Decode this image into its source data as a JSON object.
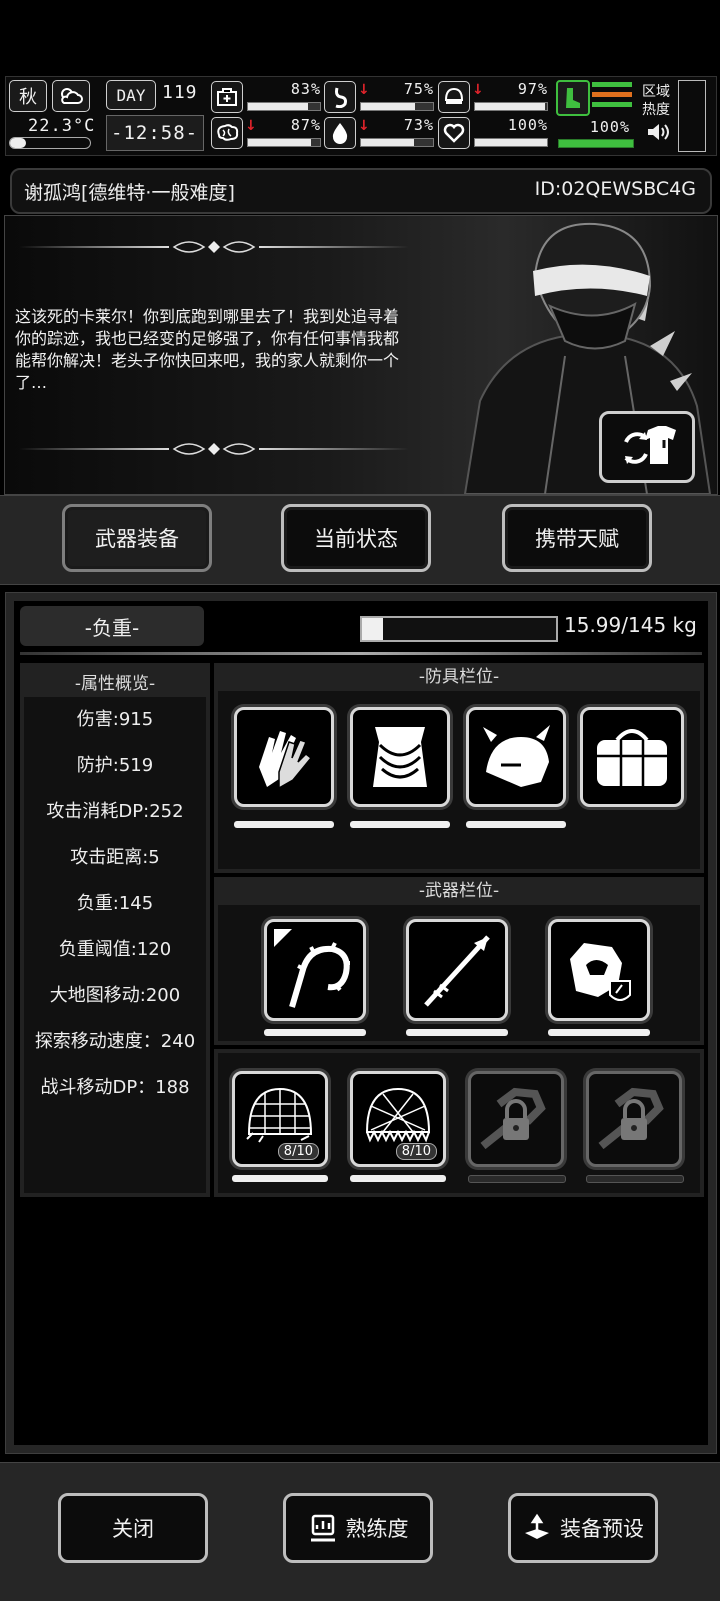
{
  "status": {
    "season": "秋",
    "temperature": "22.3°C",
    "day_label": "DAY",
    "day_number": "119",
    "clock": "-12:58-",
    "stats": [
      {
        "icon": "medkit-icon",
        "value": "83%",
        "fill": 0.83,
        "down": false
      },
      {
        "icon": "stomach-icon",
        "value": "75%",
        "fill": 0.75,
        "down": true
      },
      {
        "icon": "helmet-icon",
        "value": "97%",
        "fill": 0.97,
        "down": true
      },
      {
        "icon": "brain-icon",
        "value": "87%",
        "fill": 0.87,
        "down": true
      },
      {
        "icon": "water-drop-icon",
        "value": "73%",
        "fill": 0.73,
        "down": true
      },
      {
        "icon": "heart-icon",
        "value": "100%",
        "fill": 1.0,
        "down": false
      }
    ],
    "stamina_value": "100%",
    "region_heat_label": "区域热度",
    "colors": {
      "accent_green": "#3fbf3f",
      "accent_orange": "#e0701e",
      "alert_red": "#e0232b"
    }
  },
  "player": {
    "name": "谢孤鸿[德维特·一般难度]",
    "id": "ID:02QEWSBC4G"
  },
  "story": {
    "text": "这该死的卡莱尔！你到底跑到哪里去了！我到处追寻着你的踪迹，我也已经变的足够强了，你有任何事情我都能帮你解决！老头子你快回来吧，我的家人就剩你一个了…"
  },
  "tabs": [
    {
      "label": "武器装备",
      "active": true
    },
    {
      "label": "当前状态",
      "active": false
    },
    {
      "label": "携带天赋",
      "active": false
    }
  ],
  "load": {
    "label": "-负重-",
    "text": "15.99/145 kg",
    "fraction": 0.11
  },
  "attributes": {
    "header": "-属性概览-",
    "items": [
      "伤害:915",
      "防护:519",
      "攻击消耗DP:252",
      "攻击距离:5",
      "负重:145",
      "负重阈值:120",
      "大地图移动:200",
      "探索移动速度：240",
      "战斗移动DP：188"
    ]
  },
  "armor": {
    "header": "-防具栏位-",
    "slots": [
      {
        "icon": "gloves-icon",
        "durability": 1.0
      },
      {
        "icon": "vest-icon",
        "durability": 1.0
      },
      {
        "icon": "horned-helmet-icon",
        "durability": 1.0
      },
      {
        "icon": "bag-icon",
        "durability": null
      }
    ]
  },
  "weapons": {
    "header": "-武器栏位-",
    "slots": [
      {
        "icon": "thorn-whip-icon",
        "durability": 1.0
      },
      {
        "icon": "spear-icon",
        "durability": 1.0
      },
      {
        "icon": "armored-fist-icon",
        "durability": 1.0
      }
    ]
  },
  "consumables": {
    "slots": [
      {
        "icon": "net-trap-icon",
        "count": "8/10",
        "locked": false
      },
      {
        "icon": "spike-net-icon",
        "count": "8/10",
        "locked": false
      },
      {
        "icon": "lock-icon",
        "count": null,
        "locked": true
      },
      {
        "icon": "lock-icon",
        "count": null,
        "locked": true
      }
    ]
  },
  "bottom": {
    "close": "关闭",
    "proficiency": "熟练度",
    "preset": "装备预设"
  }
}
